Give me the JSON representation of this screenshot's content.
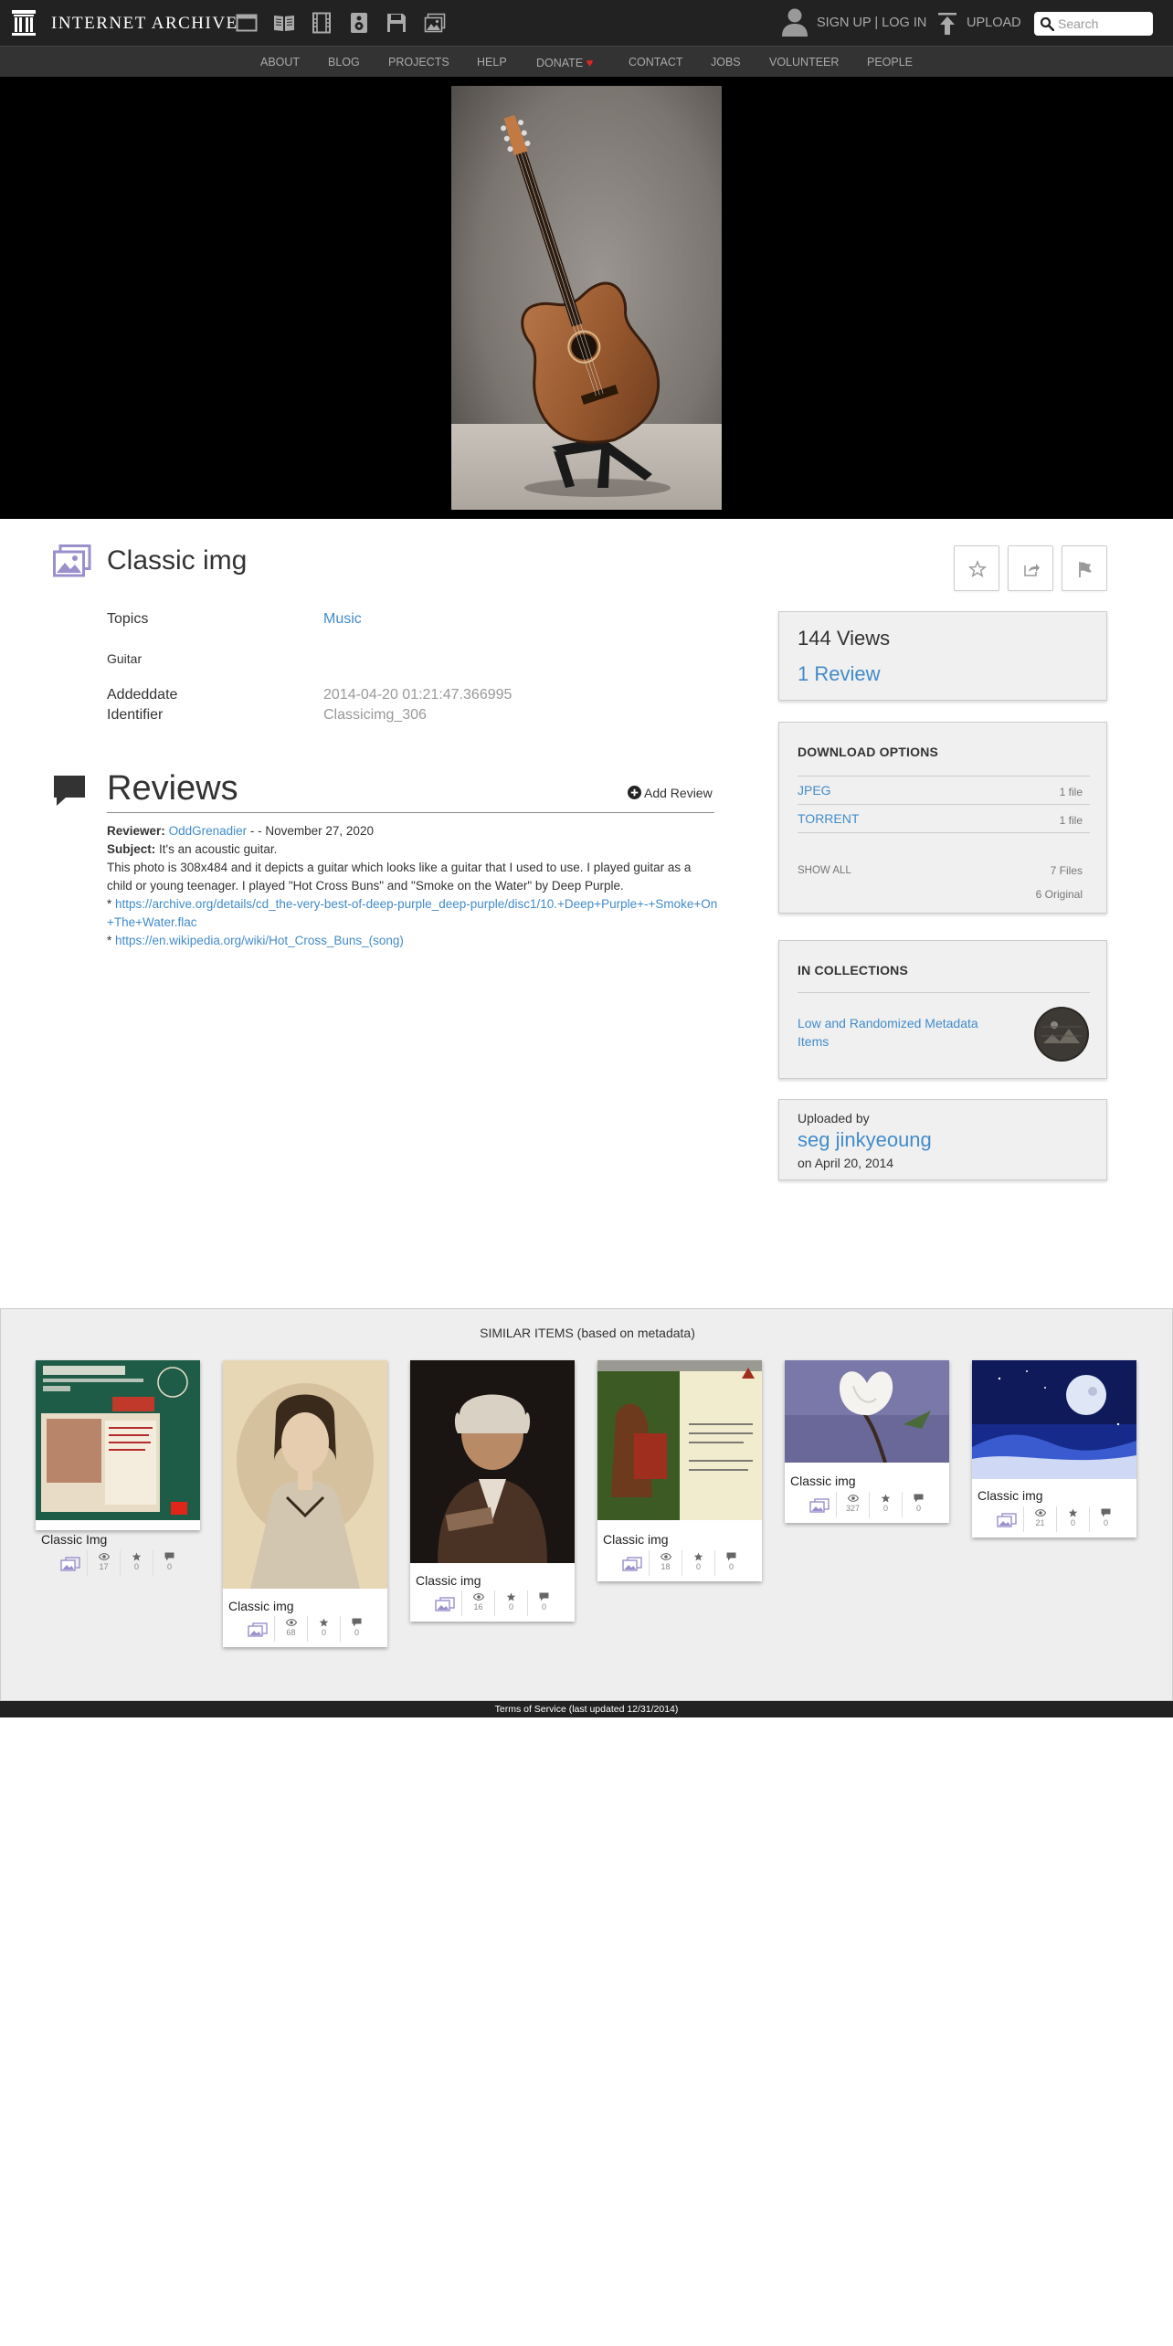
{
  "header": {
    "site_name": "INTERNET ARCHIVE",
    "media_icons": [
      "web-icon",
      "texts-icon",
      "video-icon",
      "audio-icon",
      "software-icon",
      "images-icon"
    ],
    "account_link": "SIGN UP | LOG IN",
    "upload_label": "UPLOAD",
    "search_placeholder": "Search"
  },
  "nav": [
    "ABOUT",
    "BLOG",
    "PROJECTS",
    "HELP",
    "DONATE",
    "CONTACT",
    "JOBS",
    "VOLUNTEER",
    "PEOPLE"
  ],
  "item": {
    "title": "Classic img",
    "topics_label": "Topics",
    "topic": "Music",
    "subject": "Guitar",
    "addeddate_label": "Addeddate",
    "addeddate": "2014-04-20 01:21:47.366995",
    "identifier_label": "Identifier",
    "identifier": "Classicimg_306"
  },
  "reviews": {
    "heading": "Reviews",
    "add_label": "Add Review",
    "reviewer_label": "Reviewer:",
    "reviewer": "OddGrenadier",
    "date": "- - November 27, 2020",
    "subject_label": "Subject:",
    "subject": "It's an acoustic guitar.",
    "body": "This photo is 308x484 and it depicts a guitar which looks like a guitar that I used to use. I played guitar as a child or young teenager. I played \"Hot Cross Buns\" and \"Smoke on the Water\" by Deep Purple.",
    "link1": "https://archive.org/details/cd_the-very-best-of-deep-purple_deep-purple/disc1/10.+Deep+Purple+-+Smoke+On+The+Water.flac",
    "link2": "https://en.wikipedia.org/wiki/Hot_Cross_Buns_(song)"
  },
  "stats": {
    "views": "144 Views",
    "reviews": "1 Review"
  },
  "downloads": {
    "heading": "DOWNLOAD OPTIONS",
    "rows": [
      {
        "name": "JPEG",
        "count": "1 file"
      },
      {
        "name": "TORRENT",
        "count": "1 file"
      }
    ],
    "show_all": "SHOW ALL",
    "total_files": "7 Files",
    "original": "6 Original"
  },
  "collections": {
    "heading": "IN COLLECTIONS",
    "name": "Low and Randomized Metadata Items"
  },
  "uploader": {
    "label": "Uploaded by",
    "name": "seg jinkyeoung",
    "date": "on April 20, 2014"
  },
  "similar": {
    "heading": "SIMILAR ITEMS (based on metadata)",
    "items": [
      {
        "title": "Classic Img",
        "views": "17",
        "favs": "0",
        "reviews": "0"
      },
      {
        "title": "Classic img",
        "views": "68",
        "favs": "0",
        "reviews": "0"
      },
      {
        "title": "Classic img",
        "views": "16",
        "favs": "0",
        "reviews": "0"
      },
      {
        "title": "Classic img",
        "views": "18",
        "favs": "0",
        "reviews": "0"
      },
      {
        "title": "Classic img",
        "views": "327",
        "favs": "0",
        "reviews": "0"
      },
      {
        "title": "Classic img",
        "views": "21",
        "favs": "0",
        "reviews": "0"
      }
    ]
  },
  "footer": "Terms of Service (last updated 12/31/2014)",
  "colors": {
    "link": "#428bca",
    "topbar": "#222222",
    "navbar": "#333333",
    "accent_purple": "#9b8fcc",
    "donate_heart": "#e0262b"
  }
}
